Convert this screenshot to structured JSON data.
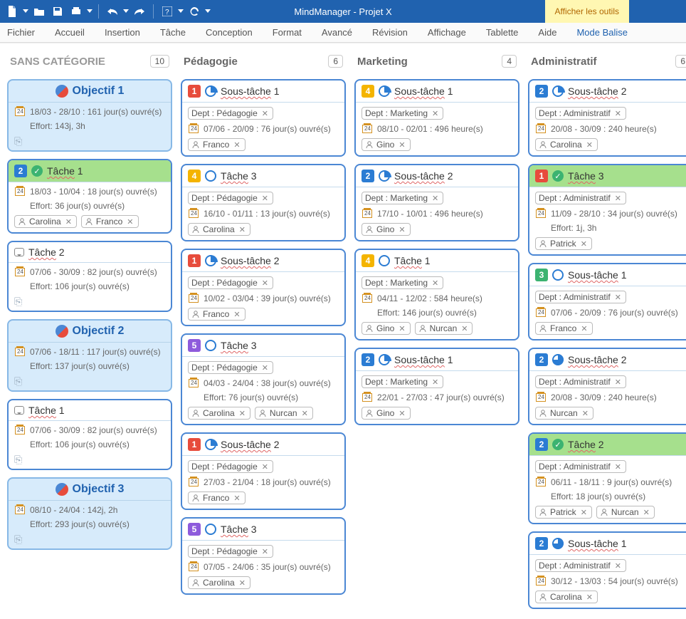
{
  "app": {
    "title": "MindManager - Projet X",
    "tools_label": "Afficher les outils"
  },
  "menu": [
    "Fichier",
    "Accueil",
    "Insertion",
    "Tâche",
    "Conception",
    "Format",
    "Avancé",
    "Révision",
    "Affichage",
    "Tablette",
    "Aide",
    "Mode Balise"
  ],
  "active_menu": "Mode Balise",
  "columns": [
    {
      "title": "SANS CATÉGORIE",
      "count": "10",
      "style": "light",
      "cards": [
        {
          "type": "objective",
          "title": "Objectif 1",
          "date": "18/03 - 28/10 : 161 jour(s) ouvré(s)",
          "effort": "Effort: 143j, 3h"
        },
        {
          "type": "task",
          "head_green": true,
          "priority": "2",
          "check": true,
          "title": "Tâche 1",
          "date": "18/03 - 10/04 : 18 jour(s) ouvré(s)",
          "effort": "Effort: 36 jour(s) ouvré(s)",
          "people": [
            "Carolina",
            "Franco"
          ]
        },
        {
          "type": "task",
          "talk": true,
          "title": "Tâche 2",
          "date": "07/06 - 30/09 : 82 jour(s) ouvré(s)",
          "effort": "Effort: 106 jour(s) ouvré(s)",
          "foot": true
        },
        {
          "type": "objective",
          "title": "Objectif 2",
          "date": "07/06 - 18/11 : 117 jour(s) ouvré(s)",
          "effort": "Effort: 137 jour(s) ouvré(s)"
        },
        {
          "type": "task",
          "talk": true,
          "title": "Tâche 1",
          "date": "07/06 - 30/09 : 82 jour(s) ouvré(s)",
          "effort": "Effort: 106 jour(s) ouvré(s)",
          "foot": true
        },
        {
          "type": "objective",
          "title": "Objectif 3",
          "date": "08/10 - 24/04 : 142j, 2h",
          "effort": "Effort: 293 jour(s) ouvré(s)"
        }
      ]
    },
    {
      "title": "Pédagogie",
      "count": "6",
      "style": "dark",
      "cards": [
        {
          "type": "task",
          "priority": "1",
          "progress": "q1",
          "title": "Sous-tâche 1",
          "dept": "Dept : Pédagogie",
          "date": "07/06 - 20/09 : 76 jour(s) ouvré(s)",
          "people": [
            "Franco"
          ]
        },
        {
          "type": "task",
          "priority": "4",
          "progress": "empty",
          "title": "Tâche 3",
          "dept": "Dept : Pédagogie",
          "date": "16/10 - 01/11 : 13 jour(s) ouvré(s)",
          "people": [
            "Carolina"
          ]
        },
        {
          "type": "task",
          "priority": "1",
          "progress": "q1",
          "title": "Sous-tâche 2",
          "dept": "Dept : Pédagogie",
          "date": "10/02 - 03/04 : 39 jour(s) ouvré(s)",
          "people": [
            "Franco"
          ]
        },
        {
          "type": "task",
          "priority": "5",
          "progress": "empty",
          "title": "Tâche 3",
          "dept": "Dept : Pédagogie",
          "date": "04/03 - 24/04 : 38 jour(s) ouvré(s)",
          "effort": "Effort: 76 jour(s) ouvré(s)",
          "people": [
            "Carolina",
            "Nurcan"
          ]
        },
        {
          "type": "task",
          "priority": "1",
          "progress": "q1",
          "title": "Sous-tâche 2",
          "dept": "Dept : Pédagogie",
          "date": "27/03 - 21/04 : 18 jour(s) ouvré(s)",
          "people": [
            "Franco"
          ]
        },
        {
          "type": "task",
          "priority": "5",
          "progress": "empty",
          "title": "Tâche 3",
          "dept": "Dept : Pédagogie",
          "date": "07/05 - 24/06 : 35 jour(s) ouvré(s)",
          "people": [
            "Carolina"
          ]
        }
      ]
    },
    {
      "title": "Marketing",
      "count": "4",
      "style": "dark",
      "cards": [
        {
          "type": "task",
          "priority": "4",
          "progress": "q1",
          "title": "Sous-tâche 1",
          "dept": "Dept : Marketing",
          "date": "08/10 - 02/01 : 496 heure(s)",
          "people": [
            "Gino"
          ]
        },
        {
          "type": "task",
          "priority": "2",
          "progress": "q1",
          "title": "Sous-tâche 2",
          "dept": "Dept : Marketing",
          "date": "17/10 - 10/01 : 496 heure(s)",
          "people": [
            "Gino"
          ]
        },
        {
          "type": "task",
          "priority": "4",
          "progress": "empty",
          "title": "Tâche 1",
          "dept": "Dept : Marketing",
          "date": "04/11 - 12/02 : 584 heure(s)",
          "effort": "Effort: 146 jour(s) ouvré(s)",
          "people": [
            "Gino",
            "Nurcan"
          ]
        },
        {
          "type": "task",
          "priority": "2",
          "progress": "q1",
          "title": "Sous-tâche 1",
          "dept": "Dept : Marketing",
          "date": "22/01 - 27/03 : 47 jour(s) ouvré(s)",
          "people": [
            "Gino"
          ]
        }
      ]
    },
    {
      "title": "Administratif",
      "count": "6",
      "style": "dark",
      "cards": [
        {
          "type": "task",
          "priority": "2",
          "progress": "q1",
          "title": "Sous-tâche 2",
          "dept": "Dept : Administratif",
          "date": "20/08 - 30/09 : 240 heure(s)",
          "people": [
            "Carolina"
          ]
        },
        {
          "type": "task",
          "head_green": true,
          "priority": "1",
          "check": true,
          "title": "Tâche 3",
          "dept": "Dept : Administratif",
          "date": "11/09 - 28/10 : 34 jour(s) ouvré(s)",
          "effort": "Effort: 1j, 3h",
          "people": [
            "Patrick"
          ]
        },
        {
          "type": "task",
          "priority": "3",
          "progress": "empty",
          "title": "Sous-tâche 1",
          "dept": "Dept : Administratif",
          "date": "07/06 - 20/09 : 76 jour(s) ouvré(s)",
          "people": [
            "Franco"
          ]
        },
        {
          "type": "task",
          "priority": "2",
          "progress": "q3",
          "title": "Sous-tâche 2",
          "dept": "Dept : Administratif",
          "date": "20/08 - 30/09 : 240 heure(s)",
          "people": [
            "Nurcan"
          ]
        },
        {
          "type": "task",
          "head_green": true,
          "priority": "2",
          "check": true,
          "title": "Tâche 2",
          "dept": "Dept : Administratif",
          "date": "06/11 - 18/11 : 9 jour(s) ouvré(s)",
          "effort": "Effort: 18 jour(s) ouvré(s)",
          "people": [
            "Patrick",
            "Nurcan"
          ]
        },
        {
          "type": "task",
          "priority": "2",
          "progress": "q3",
          "title": "Sous-tâche 1",
          "dept": "Dept : Administratif",
          "date": "30/12 - 13/03 : 54 jour(s) ouvré(s)",
          "people": [
            "Carolina"
          ]
        }
      ]
    }
  ]
}
